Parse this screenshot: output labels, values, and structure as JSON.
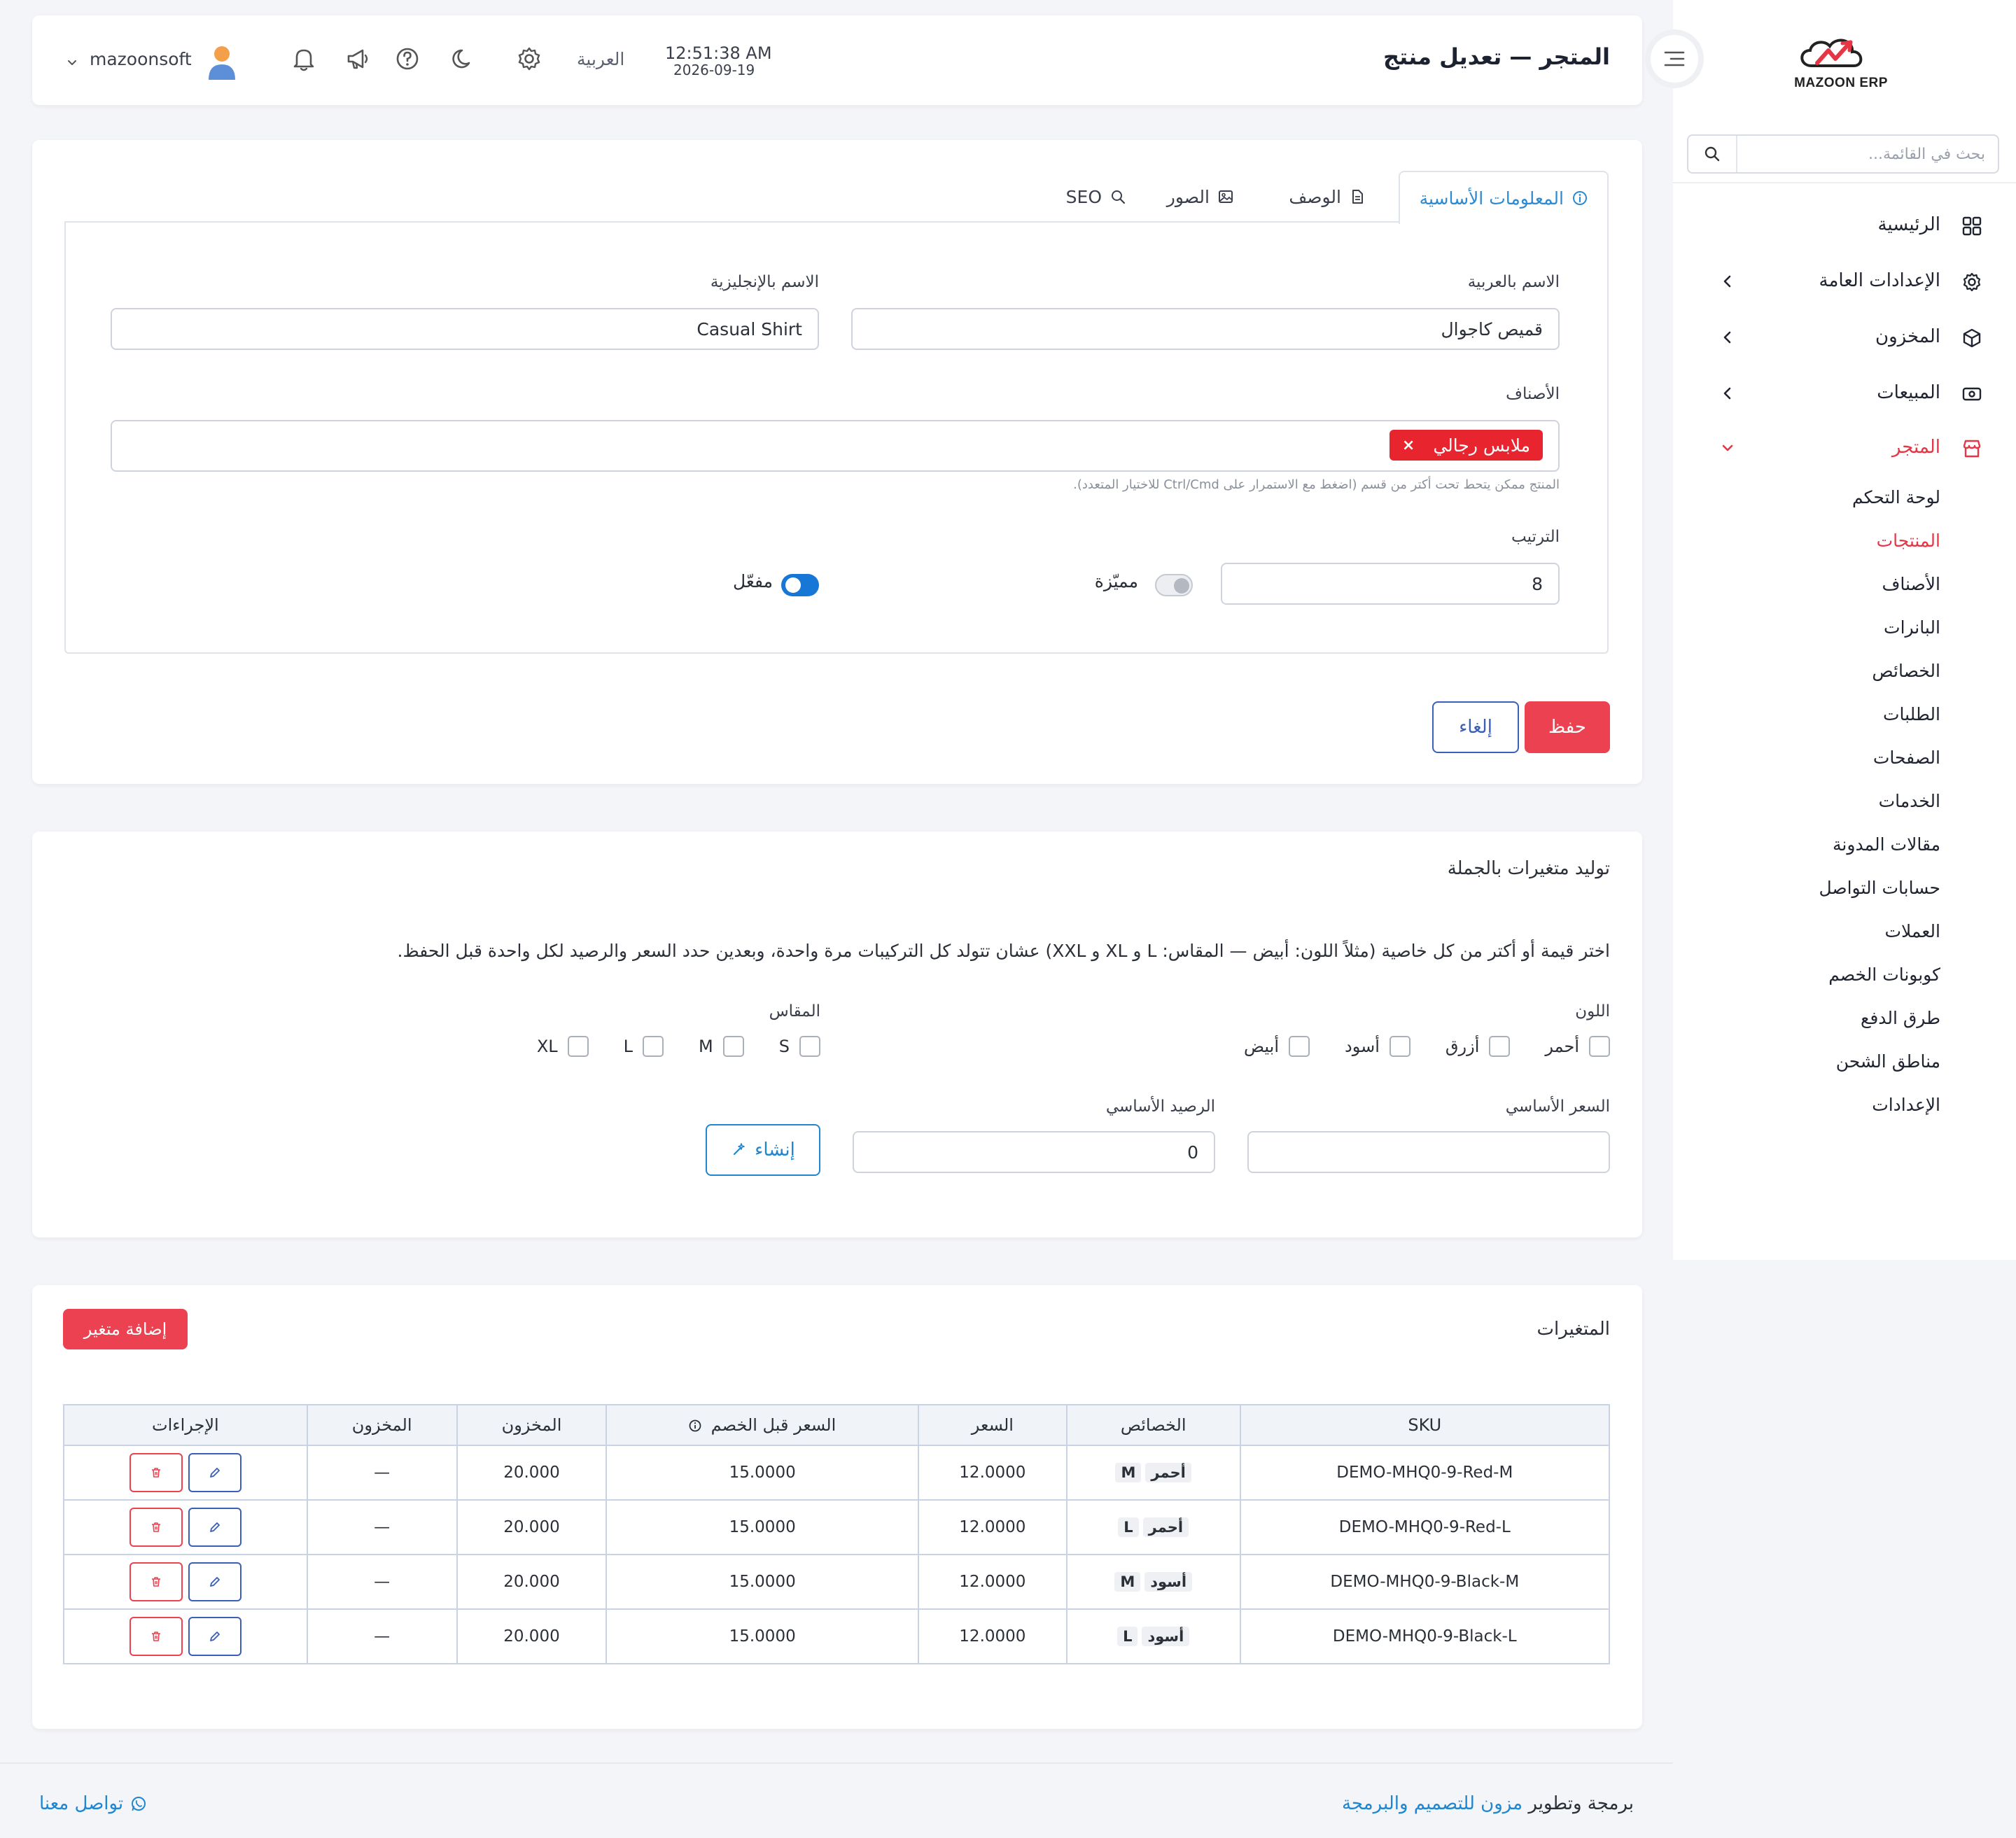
{
  "brand": {
    "name": "MAZOON ERP",
    "accent": "#e53645",
    "primary_blue": "#1f86cf"
  },
  "sidebar": {
    "search_placeholder": "بحث في القائمة...",
    "items": [
      {
        "label": "الرئيسية",
        "icon": "grid-icon"
      },
      {
        "label": "الإعدادات العامة",
        "icon": "gear-icon"
      },
      {
        "label": "المخزون",
        "icon": "box-icon"
      },
      {
        "label": "المبيعات",
        "icon": "cash-icon"
      },
      {
        "label": "المتجر",
        "icon": "store-icon"
      }
    ],
    "store_sub": [
      "لوحة التحكم",
      "المنتجات",
      "الأصناف",
      "البانرات",
      "الخصائص",
      "الطلبات",
      "الصفحات",
      "الخدمات",
      "مقالات المدونة",
      "حسابات التواصل",
      "العملات",
      "كوبونات الخصم",
      "طرق الدفع",
      "مناطق الشحن",
      "الإعدادات"
    ]
  },
  "header": {
    "title": "المتجر — تعديل منتج",
    "time": "12:51:38 AM",
    "date": "2026-09-19",
    "language": "العربية",
    "username": "mazoonsoft"
  },
  "product_form": {
    "tabs": [
      "المعلومات الأساسية",
      "الوصف",
      "الصور",
      "SEO"
    ],
    "name_ar_label": "الاسم بالعربية",
    "name_ar_value": "قميص كاجوال",
    "name_en_label": "الاسم بالإنجليزية",
    "name_en_value": "Casual Shirt",
    "categories_label": "الأصناف",
    "category_tag": "ملابس رجالي",
    "categories_hint": "المنتج ممكن يتحط تحت أكتر من قسم (اضغط مع الاستمرار على Ctrl/Cmd للاختيار المتعدد).",
    "order_label": "الترتيب",
    "order_value": "8",
    "featured_label": "مميّزة",
    "featured_on": false,
    "active_label": "مفعّل",
    "active_on": true,
    "save_label": "حفظ",
    "cancel_label": "إلغاء"
  },
  "bulk": {
    "title": "توليد متغيرات بالجملة",
    "description": "اختر قيمة أو أكتر من كل خاصية (مثلاً اللون: أبيض — المقاس: L و XL و XXL) عشان تتولد كل التركيبات مرة واحدة، وبعدين حدد السعر والرصيد لكل واحدة قبل الحفظ.",
    "color_label": "اللون",
    "colors": [
      "أحمر",
      "أزرق",
      "أسود",
      "أبيض"
    ],
    "size_label": "المقاس",
    "sizes": [
      "S",
      "M",
      "L",
      "XL"
    ],
    "base_price_label": "السعر الأساسي",
    "base_price_value": "",
    "base_stock_label": "الرصيد الأساسي",
    "base_stock_value": "0",
    "generate_label": "إنشاء"
  },
  "variants": {
    "title": "المتغيرات",
    "add_label": "إضافة متغير",
    "columns": [
      "SKU",
      "الخصائص",
      "السعر",
      "السعر قبل الخصم",
      "المخزون",
      "المخزون",
      "الإجراءات"
    ],
    "rows": [
      {
        "sku": "DEMO-MHQ0-9-Red-M",
        "color": "أحمر",
        "size": "M",
        "price": "12.0000",
        "compare_price": "15.0000",
        "stock": "20.000",
        "stock2": "—"
      },
      {
        "sku": "DEMO-MHQ0-9-Red-L",
        "color": "أحمر",
        "size": "L",
        "price": "12.0000",
        "compare_price": "15.0000",
        "stock": "20.000",
        "stock2": "—"
      },
      {
        "sku": "DEMO-MHQ0-9-Black-M",
        "color": "أسود",
        "size": "M",
        "price": "12.0000",
        "compare_price": "15.0000",
        "stock": "20.000",
        "stock2": "—"
      },
      {
        "sku": "DEMO-MHQ0-9-Black-L",
        "color": "أسود",
        "size": "L",
        "price": "12.0000",
        "compare_price": "15.0000",
        "stock": "20.000",
        "stock2": "—"
      }
    ]
  },
  "footer": {
    "credit_prefix": "برمجة وتطوير",
    "credit_link": "مزون للتصميم والبرمجة",
    "contact": "تواصل معنا"
  }
}
